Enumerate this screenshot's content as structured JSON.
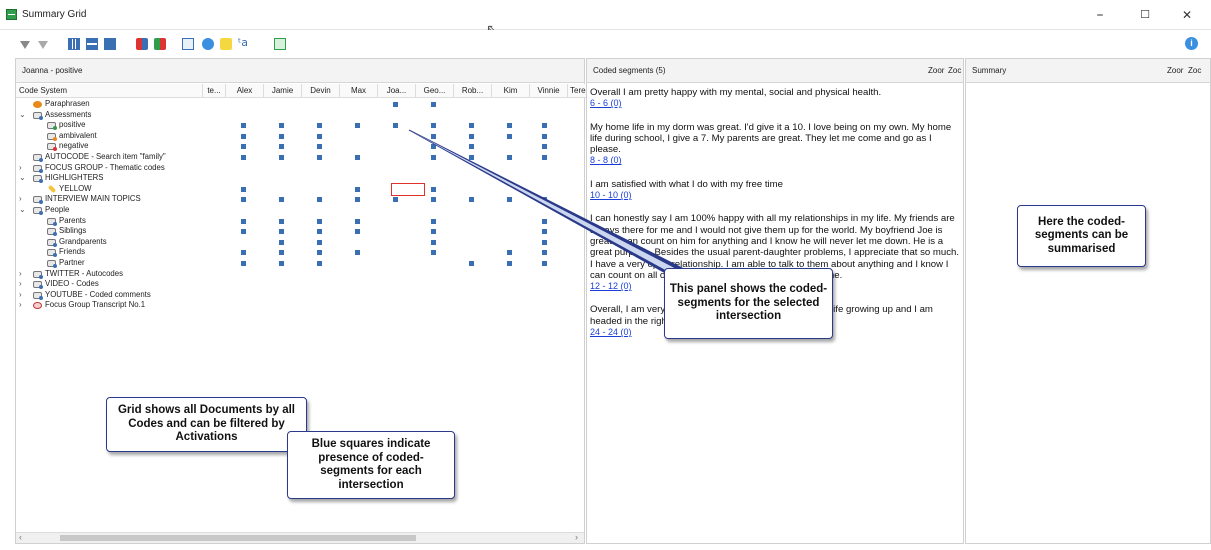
{
  "window": {
    "title": "Summary Grid",
    "minimize": "–",
    "maximize": "☐",
    "close": "✕"
  },
  "left_panel": {
    "header": "Joanna - positive",
    "code_system_label": "Code System",
    "columns": [
      "te...",
      "Alex",
      "Jamie",
      "Devin",
      "Max",
      "Joa...",
      "Geo...",
      "Rob...",
      "Kim",
      "Vinnie",
      "Tere"
    ],
    "rows": [
      "Paraphrasen",
      "Assessments",
      "positive",
      "ambivalent",
      "negative",
      "AUTOCODE - Search item \"family\"",
      "FOCUS GROUP - Thematic codes",
      "HIGHLIGHTERS",
      "YELLOW",
      "INTERVIEW MAIN TOPICS",
      "People",
      "Parents",
      "Siblings",
      "Grandparents",
      "Friends",
      "Partner",
      "TWITTER - Autocodes",
      "VIDEO - Codes",
      "YOUTUBE - Coded comments",
      "Focus Group Transcript No.1"
    ]
  },
  "middle_panel": {
    "header": "Coded segments (5)",
    "zoom_out": "Zoor",
    "zoom_in": "Zoc",
    "segments": [
      {
        "text": "Overall I am pretty happy with my mental, social and physical health.",
        "link": "6 - 6  (0)"
      },
      {
        "text": "My home life in my dorm was great. I'd give it a 10. I love being on my own. My home life during school, I give a 7. My parents are great. They let me come and go as I please.",
        "link": "8 - 8  (0)"
      },
      {
        "text": "I am satisfied with what I do with my free time",
        "link": "10 - 10  (0)"
      },
      {
        "text": "I can honestly say I am 100% happy with all my relationships in my life. My friends are always there for me and I would not give them up for the world. My boyfriend Joe is great. I can count on him for anything and I know he will never let me down. He is a great purpose. Besides the usual parent-daughter problems, I appreciate that so much. I have a very open relationship. I am able to talk to them about anything and I know I can count on all of them.. they always want the best for me.",
        "link": "12 - 12  (0)"
      },
      {
        "text": "Overall, I am very happy as I stated earlier. I had a good life growing up and I am headed in the right direction.",
        "link": "24 - 24  (0)"
      }
    ]
  },
  "right_panel": {
    "header": "Summary",
    "zoom_out": "Zoor",
    "zoom_in": "Zoc"
  },
  "callouts": {
    "grid": "Grid shows all Documents by all Codes and can be filtered by Activations",
    "blue": "Blue squares indicate presence of  coded-segments for each intersection",
    "panel": "This panel shows the coded-segments for the selected intersection",
    "summary": "Here the coded-segments can be summarised"
  },
  "colors": {
    "square": "#3a6fb3",
    "selection": "#e0312b",
    "callout_border": "#2a3a8a"
  }
}
